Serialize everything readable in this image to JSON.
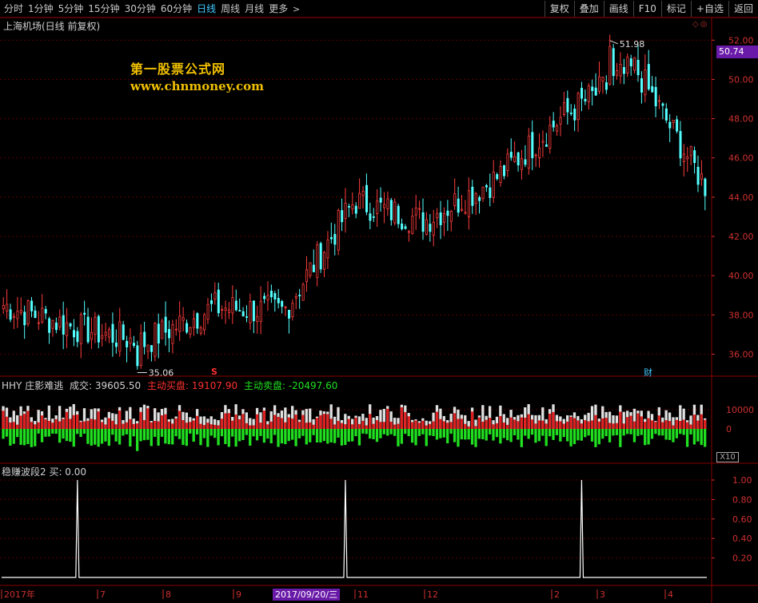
{
  "toolbar": {
    "tabs": [
      {
        "label": "分时",
        "active": false
      },
      {
        "label": "1分钟",
        "active": false
      },
      {
        "label": "5分钟",
        "active": false
      },
      {
        "label": "15分钟",
        "active": false
      },
      {
        "label": "30分钟",
        "active": false
      },
      {
        "label": "60分钟",
        "active": false
      },
      {
        "label": "日线",
        "active": true
      },
      {
        "label": "周线",
        "active": false
      },
      {
        "label": "月线",
        "active": false
      },
      {
        "label": "更多",
        "active": false
      }
    ],
    "more_arrow": ">",
    "tools": [
      "复权",
      "叠加",
      "画线",
      "F10",
      "标记",
      "+自选",
      "返回"
    ]
  },
  "chart_title": "上海机场(日线 前复权)",
  "corner_icons": "◇◎",
  "watermark": {
    "title": "第一股票公式网",
    "url": "www.chnmoney.com"
  },
  "price_axis": {
    "labels": [
      "52.00",
      "50.00",
      "48.00",
      "46.00",
      "44.00",
      "42.00",
      "40.00",
      "38.00",
      "36.00"
    ],
    "current_price": "50.74"
  },
  "annotations": {
    "high": "51.98",
    "low": "35.06"
  },
  "events": {
    "s_marker": "S",
    "cai_marker": "财"
  },
  "indicator": {
    "name": "HHY 庄影难逃",
    "volume_label": "成交: 39605.50",
    "buy_label": "主动买盘: 19107.90",
    "sell_label": "主动卖盘: -20497.60",
    "axis_labels": [
      "10000",
      "0"
    ],
    "multiplier": "X10"
  },
  "oscillator": {
    "legend": "稳赚波段2 买: 0.00",
    "axis_labels": [
      "1.00",
      "0.80",
      "0.60",
      "0.40",
      "0.20"
    ]
  },
  "time_axis": {
    "labels": [
      "2017年",
      "7",
      "8",
      "9",
      "11",
      "12",
      "2",
      "3",
      "4"
    ],
    "cursor_date": "2017/09/20/三"
  },
  "colors": {
    "up": "#ff3c3c",
    "down": "#54ffff",
    "grid": "#5a0000",
    "axis_text": "#d03030",
    "volume_up": "#e02020",
    "volume_white": "#e0e0e0",
    "volume_sell": "#20e020",
    "highlight": "#6a1aa8",
    "tab_active": "#3fc9ff",
    "watermark": "#f0c000"
  },
  "chart_data": [
    {
      "type": "candlestick",
      "title": "上海机场(日线 前复权)",
      "x_range": [
        "2017-06",
        "2018-04"
      ],
      "ylim": [
        35.0,
        52.5
      ],
      "y_ticks": [
        36,
        38,
        40,
        42,
        44,
        46,
        48,
        50,
        52
      ],
      "close_path": {
        "x": [
          "2017-06",
          "2017-07",
          "2017-08",
          "2017-09",
          "2017-10",
          "2017-11",
          "2017-12",
          "2018-01",
          "2018-02",
          "2018-03",
          "2018-04"
        ],
        "values": [
          38.5,
          37.4,
          36.6,
          38.4,
          38.2,
          43.8,
          42.8,
          44.9,
          48.2,
          50.6,
          44.6
        ]
      },
      "high": 51.98,
      "low": 35.06,
      "last": 50.74
    },
    {
      "type": "bar",
      "title": "HHY 庄影难逃",
      "series": [
        {
          "name": "主动买盘",
          "last": 19107.9
        },
        {
          "name": "主动卖盘",
          "last": -20497.6
        }
      ],
      "volume_last": 39605.5,
      "y_ticks": [
        0,
        10000
      ]
    },
    {
      "type": "line",
      "title": "稳赚波段2",
      "ylim": [
        0,
        1.0
      ],
      "y_ticks": [
        0.2,
        0.4,
        0.6,
        0.8,
        1.0
      ],
      "x": [
        "2017-06-26",
        "2017-11-13",
        "2018-03-05"
      ],
      "values": [
        1.0,
        1.0,
        1.0
      ],
      "baseline": 0,
      "last": 0.0
    }
  ]
}
